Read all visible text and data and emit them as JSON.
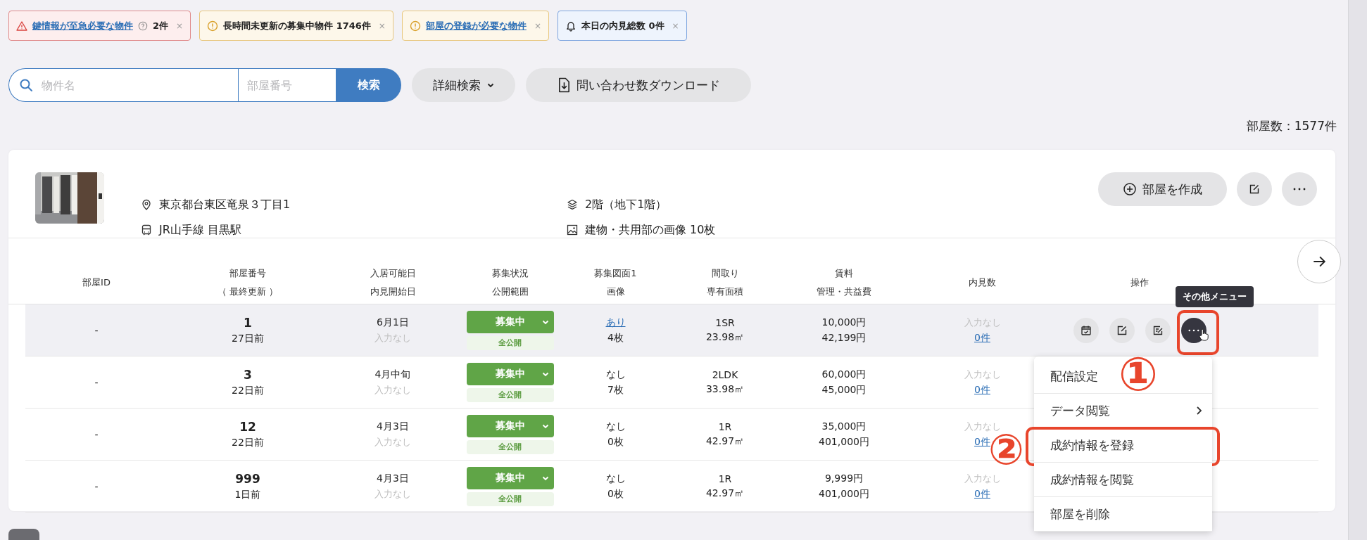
{
  "alerts": [
    {
      "kind": "danger",
      "label": "鍵情報が至急必要な物件",
      "linked": true,
      "help": true,
      "count": "2件",
      "close": "×"
    },
    {
      "kind": "warning",
      "label": "長時間未更新の募集中物件 1746件",
      "linked": false,
      "help": false,
      "close": "×"
    },
    {
      "kind": "warning",
      "label": "部屋の登録が必要な物件",
      "linked": true,
      "help": false,
      "close": "×"
    },
    {
      "kind": "info",
      "label": "本日の内見総数 0件",
      "linked": false,
      "help": false,
      "close": "×"
    }
  ],
  "search": {
    "name_placeholder": "物件名",
    "room_placeholder": "部屋番号",
    "button": "検索"
  },
  "detail_search": "詳細検索",
  "download": "問い合わせ数ダウンロード",
  "room_count": "部屋数：1577件",
  "property": {
    "address": "東京都台東区竜泉３丁目1",
    "station": "JR山手線 目黒駅",
    "floors": "2階（地下1階）",
    "images": "建物・共用部の画像 10枚",
    "create_button": "部屋を作成"
  },
  "table": {
    "columns": [
      [
        "部屋ID"
      ],
      [
        "部屋番号",
        "（ 最終更新 ）"
      ],
      [
        "入居可能日",
        "内見開始日"
      ],
      [
        "募集状況",
        "公開範囲"
      ],
      [
        "募集図面1",
        "画像"
      ],
      [
        "間取り",
        "専有面積"
      ],
      [
        "賃料",
        "管理・共益費"
      ],
      [
        "内見数"
      ],
      [
        "操作"
      ]
    ],
    "rows": [
      {
        "id": "-",
        "room": "1",
        "updated": "27日前",
        "move_in": "6月1日",
        "viewing_start": "入力なし",
        "status": "募集中",
        "scope": "全公開",
        "floorplan": "あり",
        "floorplan_linked": true,
        "images": "4枚",
        "layout": "1SR",
        "area": "23.98㎡",
        "rent": "10,000円",
        "fee": "42,199円",
        "viewing": "入力なし",
        "viewing_count": "0件",
        "highlighted": true
      },
      {
        "id": "-",
        "room": "3",
        "updated": "22日前",
        "move_in": "4月中旬",
        "viewing_start": "入力なし",
        "status": "募集中",
        "scope": "全公開",
        "floorplan": "なし",
        "floorplan_linked": false,
        "images": "7枚",
        "layout": "2LDK",
        "area": "33.98㎡",
        "rent": "60,000円",
        "fee": "45,000円",
        "viewing": "入力なし",
        "viewing_count": "0件",
        "highlighted": false
      },
      {
        "id": "-",
        "room": "12",
        "updated": "22日前",
        "move_in": "4月3日",
        "viewing_start": "入力なし",
        "status": "募集中",
        "scope": "全公開",
        "floorplan": "なし",
        "floorplan_linked": false,
        "images": "0枚",
        "layout": "1R",
        "area": "42.97㎡",
        "rent": "35,000円",
        "fee": "401,000円",
        "viewing": "入力なし",
        "viewing_count": "0件",
        "highlighted": false
      },
      {
        "id": "-",
        "room": "999",
        "updated": "1日前",
        "move_in": "4月3日",
        "viewing_start": "入力なし",
        "status": "募集中",
        "scope": "全公開",
        "floorplan": "なし",
        "floorplan_linked": false,
        "images": "0枚",
        "layout": "1R",
        "area": "42.97㎡",
        "rent": "9,999円",
        "fee": "401,000円",
        "viewing": "入力なし",
        "viewing_count": "0件",
        "highlighted": false
      }
    ]
  },
  "tooltip": "その他メニュー",
  "more_button_highlighted": true,
  "menu": [
    {
      "label": "配信設定",
      "submenu": false,
      "highlighted": false
    },
    {
      "label": "データ閲覧",
      "submenu": true,
      "highlighted": false
    },
    {
      "label": "成約情報を登録",
      "submenu": false,
      "highlighted": true
    },
    {
      "label": "成約情報を閲覧",
      "submenu": false,
      "highlighted": false
    },
    {
      "label": "部屋を削除",
      "submenu": false,
      "highlighted": false
    }
  ],
  "annotations": [
    "①",
    "②"
  ]
}
